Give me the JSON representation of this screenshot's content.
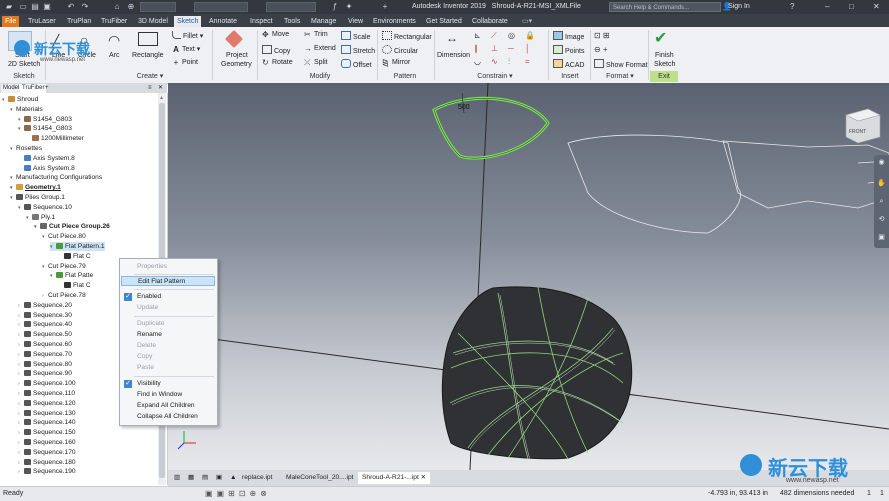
{
  "title_bar": {
    "app_title": "Autodesk Inventor 2019",
    "document": "Shroud-A-R21-MSI_XMLFile",
    "search_placeholder": "Search Help & Commands...",
    "sign_in": "Sign In",
    "help": "?",
    "minimize": "–",
    "maximize": "□",
    "close": "✕"
  },
  "ribbon_tabs": [
    "File",
    "TruLaser",
    "TruPlan",
    "TruFiber",
    "3D Model",
    "Sketch",
    "Annotate",
    "Inspect",
    "Tools",
    "Manage",
    "View",
    "Environments",
    "Get Started",
    "Collaborate"
  ],
  "ribbon": {
    "sketch_group": {
      "start": "Start",
      "two_d": "2D Sketch",
      "label": "Sketch"
    },
    "create_group": {
      "line": "Line",
      "circle": "Circle",
      "arc": "Arc",
      "rectangle": "Rectangle",
      "fillet": "Fillet",
      "text": "Text",
      "point": "Point",
      "label": "Create ▾"
    },
    "project_geometry": {
      "line1": "Project",
      "line2": "Geometry"
    },
    "modify_group": {
      "move": "Move",
      "trim": "Trim",
      "scale": "Scale",
      "copy": "Copy",
      "extend": "Extend",
      "stretch": "Stretch",
      "rotate": "Rotate",
      "split": "Split",
      "offset": "Offset",
      "label": "Modify"
    },
    "pattern_group": {
      "rectangular": "Rectangular",
      "circular": "Circular",
      "mirror": "Mirror",
      "label": "Pattern"
    },
    "constrain_group": {
      "dimension": "Dimension",
      "label": "Constrain ▾"
    },
    "insert_group": {
      "image": "Image",
      "points": "Points",
      "acad": "ACAD",
      "label": "Insert"
    },
    "format_group": {
      "show_format": "Show Format",
      "label": "Format ▾"
    },
    "exit_group": {
      "finish1": "Finish",
      "finish2": "Sketch",
      "label": "Exit"
    }
  },
  "browser": {
    "tabs": [
      "Model",
      "TruFiber",
      "+"
    ],
    "tree": [
      {
        "label": "Shroud",
        "indent": 0,
        "icon": "part-icon"
      },
      {
        "label": "Materials",
        "indent": 1,
        "icon": ""
      },
      {
        "label": "S1454_G803",
        "indent": 2,
        "icon": "material-icon"
      },
      {
        "label": "S1454_G803",
        "indent": 2,
        "icon": "material-icon"
      },
      {
        "label": "1200Millimeter",
        "indent": 3,
        "icon": "roll-icon"
      },
      {
        "label": "Rosettes",
        "indent": 1,
        "icon": ""
      },
      {
        "label": "Axis System.8",
        "indent": 2,
        "icon": "axis-icon"
      },
      {
        "label": "Axis System.8",
        "indent": 2,
        "icon": "axis-icon"
      },
      {
        "label": "Manufacturing Configurations",
        "indent": 1,
        "icon": ""
      },
      {
        "label": "Geometry.1",
        "indent": 1,
        "icon": "geometry-icon"
      },
      {
        "label": "Plies Group.1",
        "indent": 1,
        "icon": "plies-icon"
      },
      {
        "label": "Sequence.10",
        "indent": 2,
        "icon": "sequence-icon"
      },
      {
        "label": "Ply.1",
        "indent": 3,
        "icon": "ply-icon"
      },
      {
        "label": "Cut Piece Group.26",
        "indent": 4,
        "icon": "cutpiece-group-icon"
      },
      {
        "label": "Cut Piece.80",
        "indent": 5,
        "icon": ""
      },
      {
        "label": "Flat Pattern.1",
        "indent": 6,
        "icon": "flat-pattern-icon"
      },
      {
        "label": "Flat C",
        "indent": 7,
        "icon": "flat-icon"
      },
      {
        "label": "Cut Piece.79",
        "indent": 5,
        "icon": ""
      },
      {
        "label": "Flat Patte",
        "indent": 6,
        "icon": "flat-pattern-icon"
      },
      {
        "label": "Flat C",
        "indent": 7,
        "icon": "flat-icon"
      },
      {
        "label": "Cut Piece.78",
        "indent": 5,
        "icon": ""
      },
      {
        "label": "Sequence.20",
        "indent": 2,
        "icon": "sequence-icon"
      },
      {
        "label": "Sequence.30",
        "indent": 2,
        "icon": "sequence-icon"
      },
      {
        "label": "Sequence.40",
        "indent": 2,
        "icon": "sequence-icon"
      },
      {
        "label": "Sequence.50",
        "indent": 2,
        "icon": "sequence-icon"
      },
      {
        "label": "Sequence.60",
        "indent": 2,
        "icon": "sequence-icon"
      },
      {
        "label": "Sequence.70",
        "indent": 2,
        "icon": "sequence-icon"
      },
      {
        "label": "Sequence.80",
        "indent": 2,
        "icon": "sequence-icon"
      },
      {
        "label": "Sequence.90",
        "indent": 2,
        "icon": "sequence-icon"
      },
      {
        "label": "Sequence.100",
        "indent": 2,
        "icon": "sequence-icon"
      },
      {
        "label": "Sequence.110",
        "indent": 2,
        "icon": "sequence-icon"
      },
      {
        "label": "Sequence.120",
        "indent": 2,
        "icon": "sequence-icon"
      },
      {
        "label": "Sequence.130",
        "indent": 2,
        "icon": "sequence-icon"
      },
      {
        "label": "Sequence.140",
        "indent": 2,
        "icon": "sequence-icon"
      },
      {
        "label": "Sequence.150",
        "indent": 2,
        "icon": "sequence-icon"
      },
      {
        "label": "Sequence.160",
        "indent": 2,
        "icon": "sequence-icon"
      },
      {
        "label": "Sequence.170",
        "indent": 2,
        "icon": "sequence-icon"
      },
      {
        "label": "Sequence.180",
        "indent": 2,
        "icon": "sequence-icon"
      },
      {
        "label": "Sequence.190",
        "indent": 2,
        "icon": "sequence-icon"
      }
    ]
  },
  "context_menu": {
    "properties": "Properties",
    "edit_flat_pattern": "Edit Flat Pattern",
    "enabled": "Enabled",
    "update": "Update",
    "duplicate": "Duplicate",
    "rename": "Rename",
    "delete": "Delete",
    "copy": "Copy",
    "paste": "Paste",
    "visibility": "Visibility",
    "find_in_window": "Find in Window",
    "expand_all": "Expand All Children",
    "collapse_all": "Collapse All Children"
  },
  "viewport": {
    "dimension_value": "500",
    "viewcube_label": "FRONT"
  },
  "doc_tabs": [
    "replace.ipt",
    "MaleConeTool_20....ipt",
    "Shroud-A-R21-...ipt"
  ],
  "status": {
    "ready": "Ready",
    "coords": "-4.793 in, 93.413 in",
    "dimensions_needed": "482 dimensions needed",
    "count1": "1",
    "count2": "1"
  },
  "watermark": {
    "brand": "新云下载",
    "url": "www.newasp.net",
    "top_url": "www.newasp.net"
  },
  "colors": {
    "accent": "#e3791e",
    "ribbon_active_text": "#1c5aa6",
    "sketch_green": "#7ee05a",
    "selection": "#cde3f8"
  }
}
